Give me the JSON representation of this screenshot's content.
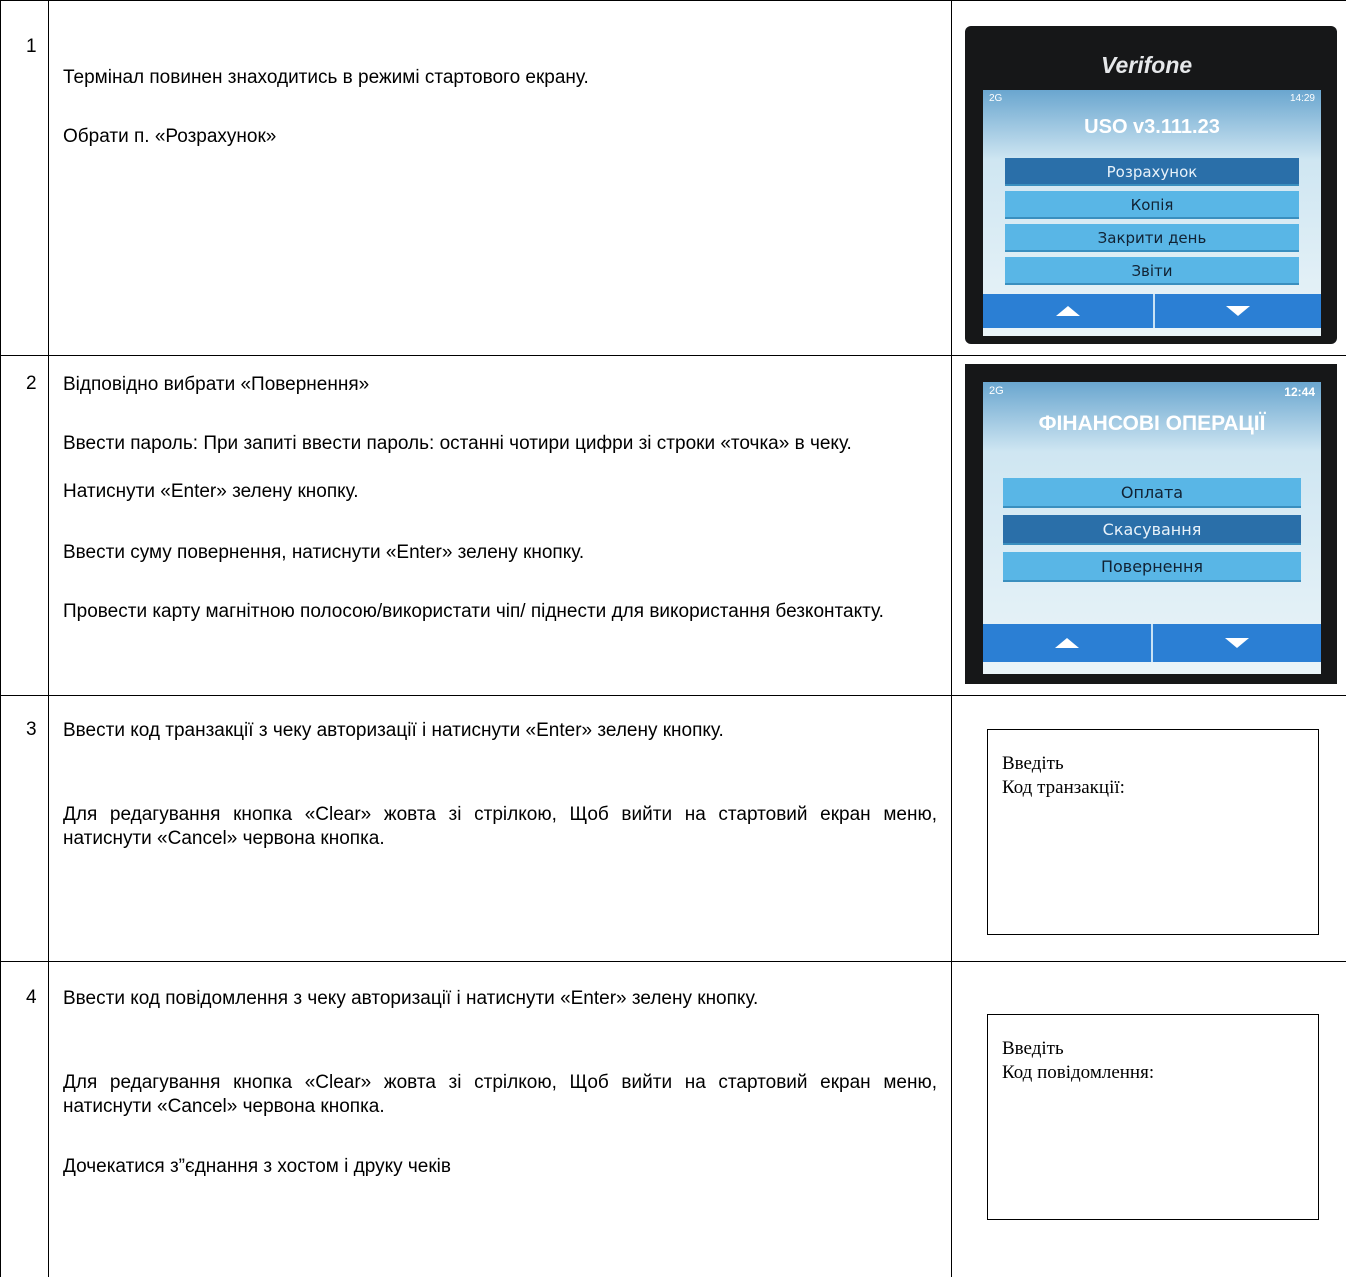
{
  "rows": [
    {
      "number": "1",
      "paragraphs": [
        "Термінал повинен знаходитись в режимі стартового екрану.",
        "Обрати п. «Розрахунок»"
      ],
      "screen": {
        "brand": "Verifone",
        "signal": "2G",
        "time": "14:29",
        "title": "USO v3.111.23",
        "menu": [
          "Розрахунок",
          "Копія",
          "Закрити день",
          "Звіти"
        ],
        "selected_item": "Розрахунок",
        "nav": [
          "up-arrow-icon",
          "down-arrow-icon"
        ]
      }
    },
    {
      "number": "2",
      "paragraphs": [
        "Відповідно вибрати «Повернення»",
        "Ввести пароль: При запиті ввести пароль: останні чотири цифри зі строки «точка» в чеку.",
        "Натиснути «Enter» зелену кнопку.",
        "Ввести суму повернення, натиснути «Enter» зелену кнопку.",
        "Провести карту магнітною полосою/використати чіп/ піднести для використання безконтакту."
      ],
      "screen": {
        "signal": "2G",
        "time": "12:44",
        "title": "ФІНАНСОВІ ОПЕРАЦІЇ",
        "menu": [
          "Оплата",
          "Скасування",
          "Повернення"
        ],
        "selected_item": "Скасування",
        "nav": [
          "up-arrow-icon",
          "down-arrow-icon"
        ]
      }
    },
    {
      "number": "3",
      "paragraphs": [
        "Ввести код транзакції з чеку авторизації і натиснути «Enter» зелену кнопку.",
        "Для редагування кнопка «Clear» жовта зі стрілкою, Щоб вийти на стартовий екран меню, натиснути «Cancel» червона кнопка."
      ],
      "box": {
        "line1": "Введіть",
        "line2": "Код транзакції:"
      }
    },
    {
      "number": "4",
      "paragraphs": [
        "Ввести код повідомлення з чеку авторизації і натиснути «Enter» зелену кнопку.",
        "Для редагування кнопка «Clear» жовта зі стрілкою, Щоб вийти на стартовий екран меню, натиснути «Cancel» червона кнопка.",
        "Дочекатися з”єднання з хостом і друку чеків"
      ],
      "box": {
        "line1": "Введіть",
        "line2": "Код повідомлення:"
      }
    }
  ],
  "colors": {
    "border": "#000000",
    "terminal_body": "#161718",
    "menu_item": "#59b6e6",
    "menu_selected": "#2a6fa9",
    "nav_bar": "#2b7fd4"
  }
}
